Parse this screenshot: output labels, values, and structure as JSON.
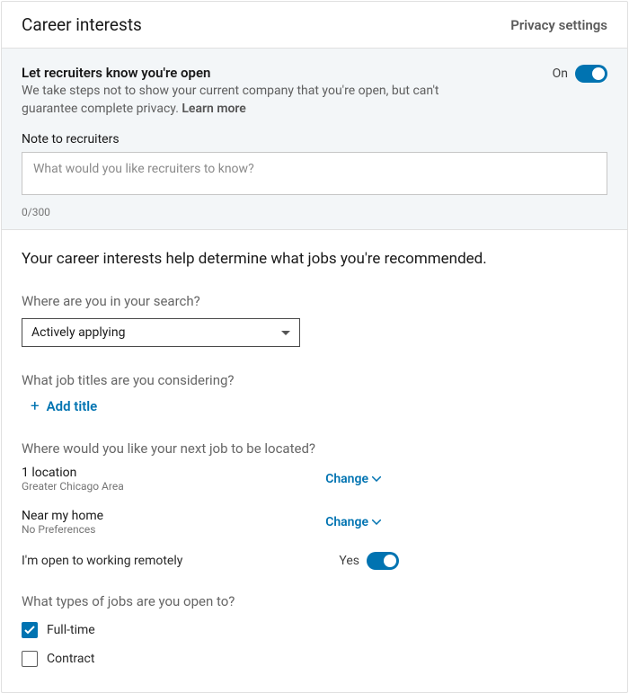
{
  "header": {
    "title": "Career interests",
    "privacy": "Privacy settings"
  },
  "open_section": {
    "title": "Let recruiters know you're open",
    "desc": "We take steps not to show your current company that you're open, but can't guarantee complete privacy. ",
    "learn_more": "Learn more",
    "toggle_label": "On"
  },
  "note": {
    "label": "Note to recruiters",
    "placeholder": "What would you like recruiters to know?",
    "count": "0/300"
  },
  "headline": "Your career interests help determine what jobs you're recommended.",
  "search_stage": {
    "question": "Where are you in your search?",
    "value": "Actively applying"
  },
  "titles": {
    "question": "What job titles are you considering?",
    "add_label": "Add title"
  },
  "location": {
    "question": "Where would you like your next job to be located?",
    "items": [
      {
        "title": "1 location",
        "sub": "Greater Chicago Area",
        "change": "Change"
      },
      {
        "title": "Near my home",
        "sub": "No Preferences",
        "change": "Change"
      }
    ]
  },
  "remote": {
    "label": "I'm open to working remotely",
    "toggle_label": "Yes"
  },
  "job_types": {
    "question": "What types of jobs are you open to?",
    "options": [
      {
        "label": "Full-time",
        "checked": true
      },
      {
        "label": "Contract",
        "checked": false
      }
    ]
  }
}
